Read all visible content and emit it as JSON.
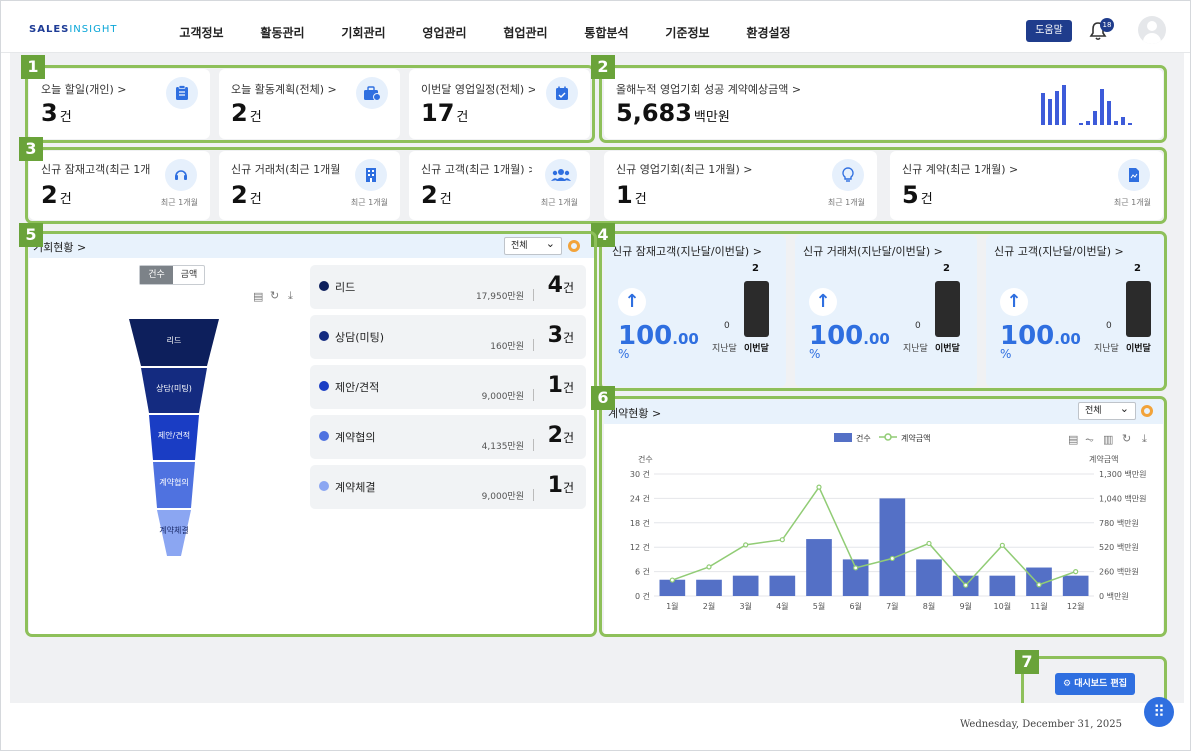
{
  "header": {
    "logo_main": "SALES",
    "logo_sub": "INSIGHT",
    "nav": [
      "고객정보",
      "활동관리",
      "기회관리",
      "영업관리",
      "협업관리",
      "통합분석",
      "기준정보",
      "환경설정"
    ],
    "help_label": "도움말",
    "notif_count": "18"
  },
  "markers": [
    "1",
    "2",
    "3",
    "4",
    "5",
    "6",
    "7"
  ],
  "row1": [
    {
      "title": "오늘 할일(개인) >",
      "value": "3",
      "unit": "건",
      "icon": "clipboard-icon"
    },
    {
      "title": "오늘 활동계획(전체) >",
      "value": "2",
      "unit": "건",
      "icon": "briefcase-icon"
    },
    {
      "title": "이번달 영업일정(전체) >",
      "value": "17",
      "unit": "건",
      "icon": "calendar-check-icon"
    }
  ],
  "annual": {
    "title": "올해누적 영업기회 성공 계약예상금액 >",
    "value": "5,683",
    "unit": "백만원"
  },
  "row3": [
    {
      "title": "신규 잠재고객(최근 1개",
      "value": "2",
      "unit": "건",
      "note": "최근 1개월",
      "icon": "headset-icon"
    },
    {
      "title": "신규 거래처(최근 1개월",
      "value": "2",
      "unit": "건",
      "note": "최근 1개월",
      "icon": "building-icon"
    },
    {
      "title": "신규 고객(최근 1개월) >",
      "value": "2",
      "unit": "건",
      "note": "최근 1개월",
      "icon": "users-icon"
    },
    {
      "title": "신규 영업기회(최근 1개월) >",
      "value": "1",
      "unit": "건",
      "note": "최근 1개월",
      "icon": "lightbulb-icon"
    },
    {
      "title": "신규 계약(최근 1개월) >",
      "value": "5",
      "unit": "건",
      "note": "최근 1개월",
      "icon": "document-icon"
    }
  ],
  "opportunity": {
    "title": "기회현황 >",
    "filter": "전체",
    "toggle": [
      "건수",
      "금액"
    ],
    "funnel": [
      {
        "label": "리드",
        "amount": "17,950만원",
        "count": "4",
        "unit": "건",
        "color": "#0d1f5c"
      },
      {
        "label": "상담(미팅)",
        "amount": "160만원",
        "count": "3",
        "unit": "건",
        "color": "#142b80"
      },
      {
        "label": "제안/견적",
        "amount": "9,000만원",
        "count": "1",
        "unit": "건",
        "color": "#1a3dc4"
      },
      {
        "label": "계약협의",
        "amount": "4,135만원",
        "count": "2",
        "unit": "건",
        "color": "#4f72e0"
      },
      {
        "label": "계약체결",
        "amount": "9,000만원",
        "count": "1",
        "unit": "건",
        "color": "#8ba6f2"
      }
    ]
  },
  "comparisons": [
    {
      "title": "신규 잠재고객(지난달/이번달) >",
      "pct": "100",
      "pct_dec": ".00",
      "pct_sym": "%",
      "prev_val": "0",
      "cur_val": "2",
      "prev_label": "지난달",
      "cur_label": "이번달"
    },
    {
      "title": "신규 거래처(지난달/이번달) >",
      "pct": "100",
      "pct_dec": ".00",
      "pct_sym": "%",
      "prev_val": "0",
      "cur_val": "2",
      "prev_label": "지난달",
      "cur_label": "이번달"
    },
    {
      "title": "신규 고객(지난달/이번달) >",
      "pct": "100",
      "pct_dec": ".00",
      "pct_sym": "%",
      "prev_val": "0",
      "cur_val": "2",
      "prev_label": "지난달",
      "cur_label": "이번달"
    }
  ],
  "contract": {
    "title": "계약현황 >",
    "filter": "전체"
  },
  "chart_data": {
    "type": "bar",
    "categories": [
      "1월",
      "2월",
      "3월",
      "4월",
      "5월",
      "6월",
      "7월",
      "8월",
      "9월",
      "10월",
      "11월",
      "12월"
    ],
    "series": [
      {
        "name": "건수",
        "type": "bar",
        "axis": "left",
        "values": [
          4,
          4,
          5,
          5,
          14,
          9,
          24,
          9,
          5,
          5,
          7,
          5
        ],
        "color": "#5470c6"
      },
      {
        "name": "계약금액",
        "type": "line",
        "axis": "right",
        "values": [
          170,
          310,
          545,
          600,
          1160,
          300,
          400,
          560,
          115,
          540,
          120,
          260
        ],
        "color": "#91cc75"
      }
    ],
    "ylabel": "건수",
    "y2label": "계약금액",
    "ylim": [
      0,
      30
    ],
    "y2lim": [
      0,
      1300
    ],
    "yticks": [
      "0 건",
      "6 건",
      "12 건",
      "18 건",
      "24 건",
      "30 건"
    ],
    "y2ticks": [
      "0 백만원",
      "260 백만원",
      "520 백만원",
      "780 백만원",
      "1,040 백만원",
      "1,300 백만원"
    ],
    "grid": true,
    "legend": "top-center"
  },
  "dashboard_edit": "대시보드 편집",
  "footer_date": "Wednesday, December 31, 2025"
}
